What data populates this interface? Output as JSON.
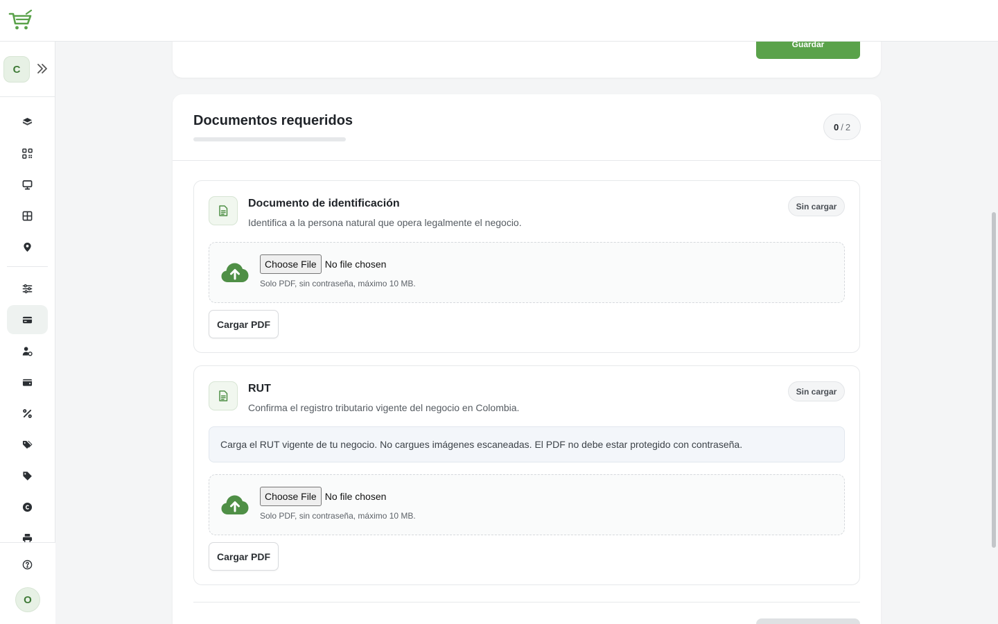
{
  "app": {
    "workspace_initial": "C",
    "user_initial": "O",
    "accent_color": "#5aa24a"
  },
  "sidebar": {
    "items": [
      {
        "icon": "cube-icon"
      },
      {
        "icon": "qr-code-icon"
      },
      {
        "icon": "monitor-icon"
      },
      {
        "icon": "grid-icon"
      },
      {
        "icon": "location-pin-icon"
      },
      {
        "icon": "sliders-icon"
      },
      {
        "icon": "credit-card-icon",
        "active": true
      },
      {
        "icon": "user-settings-icon"
      },
      {
        "icon": "wallet-icon"
      },
      {
        "icon": "percent-icon"
      },
      {
        "icon": "tags-icon"
      },
      {
        "icon": "tag-icon"
      },
      {
        "icon": "copyright-icon"
      },
      {
        "icon": "printer-icon"
      }
    ],
    "help_icon": "help-circle-icon"
  },
  "top_card": {
    "save_label": "Guardar"
  },
  "documents_card": {
    "title": "Documentos requeridos",
    "progress_done": "0",
    "progress_total": "2",
    "documents": [
      {
        "title": "Documento de identificación",
        "description": "Identifica a la persona natural que opera legalmente el negocio.",
        "status": "Sin cargar",
        "choose_file_label": "Choose File",
        "no_file_label": "No file chosen",
        "hint": "Solo PDF, sin contraseña, máximo 10 MB.",
        "upload_label": "Cargar PDF"
      },
      {
        "title": "RUT",
        "description": "Confirma el registro tributario vigente del negocio en Colombia.",
        "status": "Sin cargar",
        "note": "Carga el RUT vigente de tu negocio. No cargues imágenes escaneadas. El PDF no debe estar protegido con contraseña.",
        "choose_file_label": "Choose File",
        "no_file_label": "No file chosen",
        "hint": "Solo PDF, sin contraseña, máximo 10 MB.",
        "upload_label": "Cargar PDF"
      }
    ]
  }
}
